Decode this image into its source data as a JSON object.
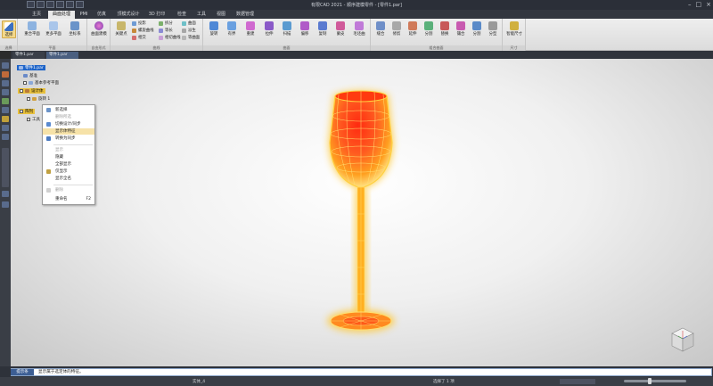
{
  "window": {
    "title": "有限CAD 2021 - 顺序建模零件 - [零件1.par]"
  },
  "ribbon_tabs": [
    "主页",
    "曲面处理",
    "PMI",
    "仿真",
    "顶模式设计",
    "3D 打印",
    "检查",
    "工具",
    "视图",
    "数据管理"
  ],
  "ribbon_groups": {
    "select": {
      "label": "选择",
      "button": "选择"
    },
    "plane": {
      "label": "平面",
      "buttons": [
        "重合平面",
        "更多平面",
        "坐标系"
      ]
    },
    "freeform": {
      "label": "自由形式",
      "buttons": [
        "曲面建模"
      ]
    },
    "curve": {
      "label": "曲线",
      "buttons": [
        "关键点",
        "投影",
        "螺旋曲线",
        "相交",
        "拆分",
        "等长",
        "相切曲线",
        "曲面",
        "派生",
        "等曲面",
        "交点"
      ]
    },
    "surface": {
      "label": "曲面",
      "buttons": [
        "旋转",
        "有界",
        "重建",
        "拉伸",
        "扫描",
        "偏移",
        "复制",
        "蒙皮",
        "毛坯曲"
      ]
    },
    "combine": {
      "label": "组合曲面",
      "buttons": [
        "缝合",
        "修剪",
        "延伸",
        "分割",
        "替换",
        "镶合",
        "分割",
        "分型"
      ]
    },
    "size": {
      "label": "尺寸",
      "buttons": [
        "智能尺寸"
      ]
    }
  },
  "doc_tabs": [
    "零件1.par",
    "零件1.par"
  ],
  "tree": {
    "items": [
      "零件1.par",
      "基准",
      "基本参考平面",
      "设计体",
      "旋转 1",
      "阵列",
      "工具"
    ]
  },
  "context_menu": {
    "items": [
      {
        "label": "新选择",
        "disabled": false
      },
      {
        "label": "删除所选",
        "disabled": true
      },
      {
        "label": "切换设计/同步",
        "disabled": false
      },
      {
        "label": "显示体特征",
        "disabled": false,
        "hover": true
      },
      {
        "label": "转换为同步",
        "disabled": false
      },
      {
        "label": "显示",
        "disabled": true
      },
      {
        "label": "隐藏",
        "disabled": false
      },
      {
        "label": "全部显示",
        "disabled": false
      },
      {
        "label": "仅显示",
        "disabled": false
      },
      {
        "label": "显示全名",
        "disabled": false
      },
      {
        "label": "删除",
        "disabled": true
      },
      {
        "label": "重命名",
        "disabled": false,
        "shortcut": "F2"
      }
    ]
  },
  "command_line": {
    "label": "提示条",
    "text": "显示属于选定体的特征。"
  },
  "status": {
    "left": "实体_4",
    "middle": "选择了 1 项"
  },
  "colors": {
    "accent": "#1e64c8",
    "glass_glow": "#ffb000",
    "glass_fill": "#ff4a1a",
    "titlebar": "#2b2f38"
  }
}
